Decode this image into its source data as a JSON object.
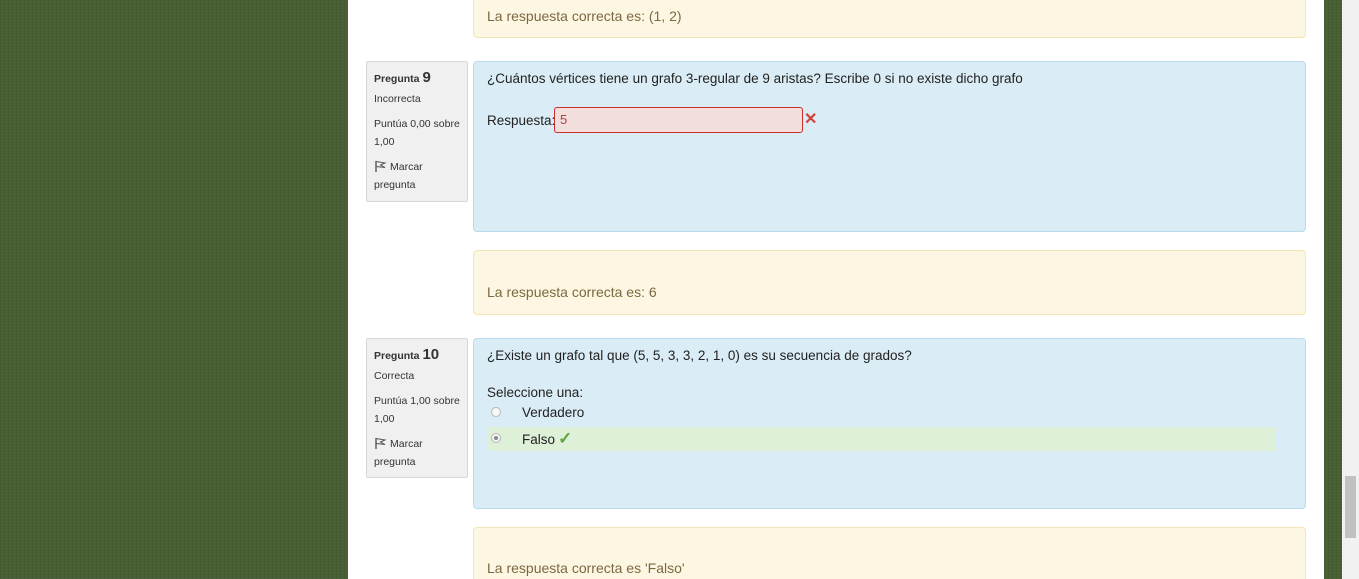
{
  "prev_question": {
    "correct_answer": "La respuesta correcta es: (1, 2)"
  },
  "q9": {
    "label": "Pregunta",
    "number": "9",
    "state": "Incorrecta",
    "grade": "Puntúa 0,00 sobre 1,00",
    "flag": "Marcar pregunta",
    "text": "¿Cuántos vértices tiene un grafo 3-regular de 9 aristas? Escribe 0 si no existe dicho grafo",
    "answer_label": "Respuesta:",
    "answer_value": "5",
    "result_icon": "cross-icon",
    "correct_answer": "La respuesta correcta es: 6"
  },
  "q10": {
    "label": "Pregunta",
    "number": "10",
    "state": "Correcta",
    "grade": "Puntúa 1,00 sobre 1,00",
    "flag": "Marcar pregunta",
    "text": "¿Existe un grafo tal que (5, 5, 3, 3, 2, 1, 0) es su secuencia de grados?",
    "prompt": "Seleccione una:",
    "options": [
      {
        "label": "Verdadero",
        "checked": false
      },
      {
        "label": "Falso",
        "checked": true
      }
    ],
    "result_icon": "check-icon",
    "correct_answer": "La respuesta correcta es 'Falso'"
  },
  "colors": {
    "background": "#475f33",
    "question_bg": "#daecf5",
    "outcome_bg": "#fdf6e3",
    "incorrect": "#d43f3a",
    "correct": "#5ca642"
  }
}
